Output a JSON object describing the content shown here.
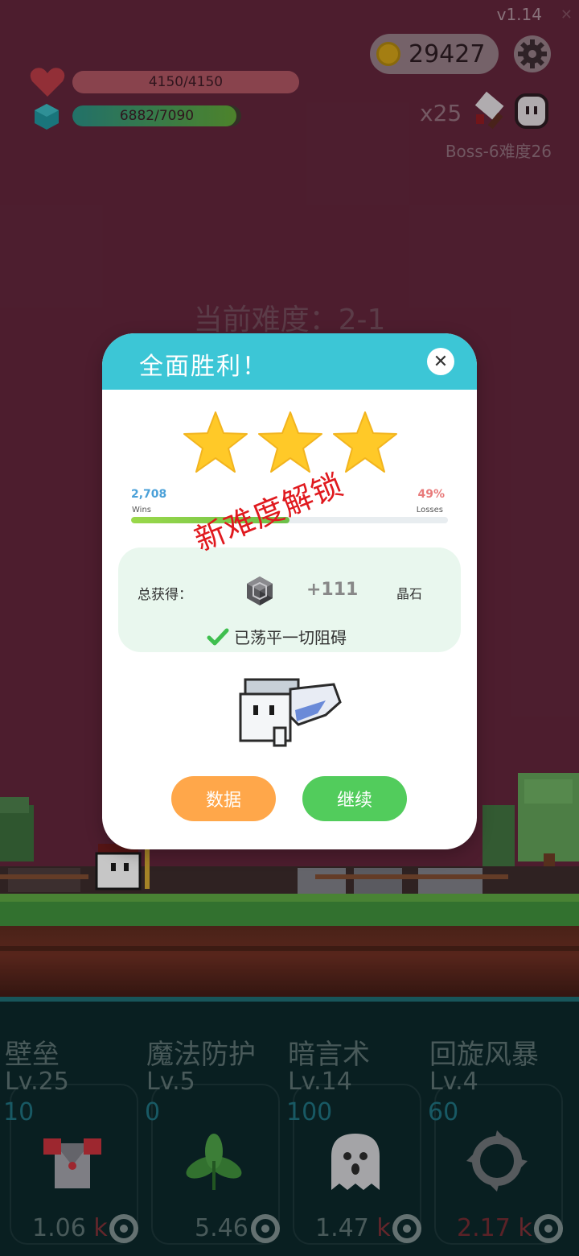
{
  "hud": {
    "version": "v1.14",
    "coins": "29427",
    "hp_text": "4150/4150",
    "hp_fraction": 1.0,
    "mp_text": "6882/7090",
    "mp_fraction": 0.97,
    "multiplier": "x25",
    "boss_text": "Boss-6难度26",
    "difficulty_text": "当前难度：2-1"
  },
  "modal": {
    "title": "全面胜利！",
    "close_label": "✕",
    "stars_earned": 3,
    "wins_value": "2,708",
    "wins_label": "Wins",
    "losses_value": "49%",
    "losses_label": "Losses",
    "win_fraction": 0.5,
    "unlock_stamp": "新难度解锁",
    "reward_label": "总获得：",
    "reward_amount": "+111",
    "reward_unit": "晶石",
    "clear_text": "已荡平一切阻碍",
    "stats_button": "数据",
    "continue_button": "继续"
  },
  "skills": [
    {
      "name": "壁垒",
      "level": "Lv.25",
      "cost": "10",
      "value": "1.06",
      "unit": "k",
      "icon": "armor-icon"
    },
    {
      "name": "魔法防护",
      "level": "Lv.5",
      "cost": "0",
      "value": "5.46",
      "unit": "",
      "icon": "leaf-icon"
    },
    {
      "name": "暗言术",
      "level": "Lv.14",
      "cost": "100",
      "value": "1.47",
      "unit": "k",
      "icon": "ghost-icon"
    },
    {
      "name": "回旋风暴",
      "level": "Lv.4",
      "cost": "60",
      "value": "2.17",
      "unit": "k",
      "icon": "whirlwind-icon"
    }
  ],
  "colors": {
    "accent_header": "#3cc6d6",
    "stats_button": "#ffa74a",
    "continue_button": "#52cc5c",
    "stamp": "#e0191e",
    "star": "#ffc928"
  }
}
